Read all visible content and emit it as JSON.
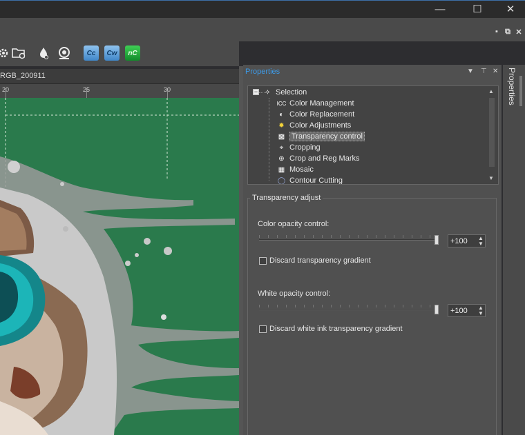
{
  "window": {
    "minimize_icon": "minimize-icon",
    "maximize_icon": "maximize-icon",
    "close_icon": "close-icon"
  },
  "toolbar": {
    "icons": [
      "settings-icon",
      "folder-sync-icon",
      "ink-drop-icon",
      "spot-color-icon"
    ],
    "cc_label": "Cc",
    "cw_label": "Cw",
    "nc_label": "nC"
  },
  "document": {
    "tab_label": "RGB_200911",
    "ruler": [
      "20",
      "25",
      "30"
    ]
  },
  "properties": {
    "title": "Properties",
    "side_tab": "Properties",
    "tree": [
      {
        "label": "Selection",
        "icon": "selection-icon"
      },
      {
        "label": "Color Management",
        "icon": "icc-icon",
        "icon_text": "ICC"
      },
      {
        "label": "Color Replacement",
        "icon": "color-replacement-icon"
      },
      {
        "label": "Color Adjustments",
        "icon": "color-adjustments-icon"
      },
      {
        "label": "Transparency control",
        "icon": "transparency-icon",
        "selected": true
      },
      {
        "label": "Cropping",
        "icon": "crop-icon"
      },
      {
        "label": "Crop and Reg Marks",
        "icon": "reg-marks-icon"
      },
      {
        "label": "Mosaic",
        "icon": "mosaic-icon"
      },
      {
        "label": "Contour Cutting",
        "icon": "contour-cutting-icon"
      }
    ],
    "group_title": "Transparency adjust",
    "color_opacity": {
      "label": "Color opacity control:",
      "value": "+100",
      "level": 1.0,
      "discard_label": "Discard transparency gradient",
      "discard_checked": false
    },
    "white_opacity": {
      "label": "White opacity control:",
      "value": "+100",
      "level": 1.0,
      "discard_label": "Discard white ink transparency gradient",
      "discard_checked": false
    }
  },
  "colors": {
    "canvas_background": "#2a7a4c",
    "accent": "#3d9be9",
    "selected_item": "#6a6a6a"
  }
}
